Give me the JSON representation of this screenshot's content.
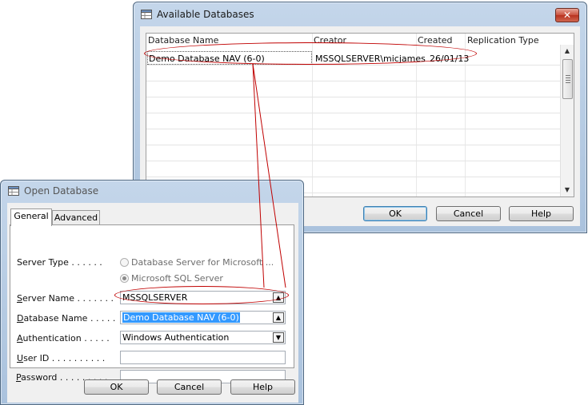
{
  "available_databases": {
    "title": "Available Databases",
    "close_glyph": "✕",
    "columns": [
      "Database Name",
      "Creator",
      "Created",
      "Replication Type"
    ],
    "rows": [
      {
        "name": "Demo Database NAV (6-0)",
        "creator": "MSSQLSERVER\\micjames",
        "created": "26/01/13",
        "replication": ""
      }
    ],
    "ok_label": "OK",
    "cancel_label": "Cancel",
    "help_label": "Help"
  },
  "open_database": {
    "title": "Open Database",
    "tabs": [
      "General",
      "Advanced"
    ],
    "active_tab": "General",
    "server_type": {
      "label_pre": "Server Type",
      "label_dots": " . . . . . .",
      "options": [
        "Database Server for Microsoft ...",
        "Microsoft SQL Server"
      ],
      "selected": "Microsoft SQL Server"
    },
    "server_name": {
      "label_u": "S",
      "label_rest": "erver Name",
      "label_dots": " . . . . . . .",
      "value": "MSSQLSERVER"
    },
    "database_name": {
      "label_u": "D",
      "label_rest": "atabase Name",
      "label_dots": " . . . . .",
      "value": "Demo Database NAV (6-0)"
    },
    "authentication": {
      "label_u": "A",
      "label_rest": "uthentication",
      "label_dots": " . . . . .",
      "value": "Windows Authentication"
    },
    "user_id": {
      "label_u": "U",
      "label_rest": "ser ID",
      "label_dots": " . . . . . . . . . .",
      "value": ""
    },
    "password": {
      "label_u": "P",
      "label_rest": "assword",
      "label_dots": " . . . . . . . . .",
      "value": ""
    },
    "ok_label": "OK",
    "cancel_label": "Cancel",
    "help_label": "Help"
  },
  "colors": {
    "annotation": "#c00000",
    "selection": "#3399ff"
  }
}
